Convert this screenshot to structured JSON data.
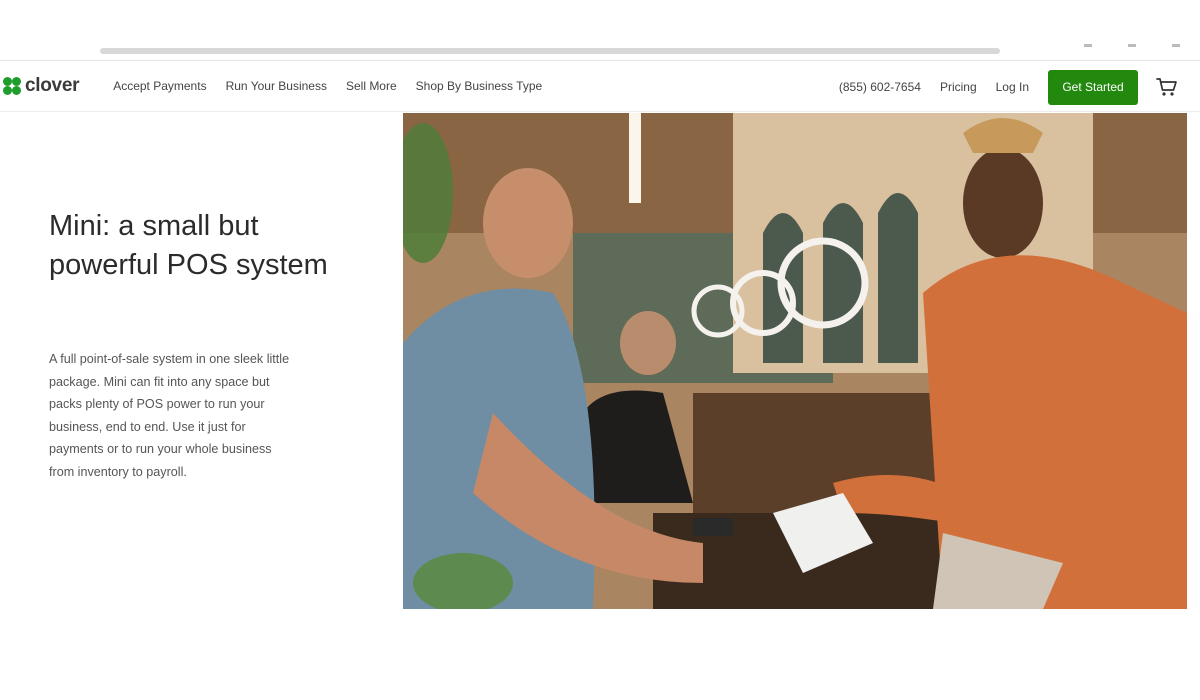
{
  "header": {
    "logo_text": "clover",
    "nav_left": [
      "Accept Payments",
      "Run Your Business",
      "Sell More",
      "Shop By Business Type"
    ],
    "phone": "(855) 602-7654",
    "pricing_label": "Pricing",
    "login_label": "Log In",
    "cta_label": "Get Started",
    "cart_icon": "cart-icon"
  },
  "hero": {
    "title": "Mini: a small but powerful POS system",
    "body": "A full point-of-sale system in one sleek little package. Mini can fit into any space but packs plenty of POS power to run your business, end to end. Use it just for payments or to run your whole business from inventory to payroll."
  },
  "colors": {
    "brand_green": "#1f9d2c",
    "cta_green": "#22880e"
  }
}
